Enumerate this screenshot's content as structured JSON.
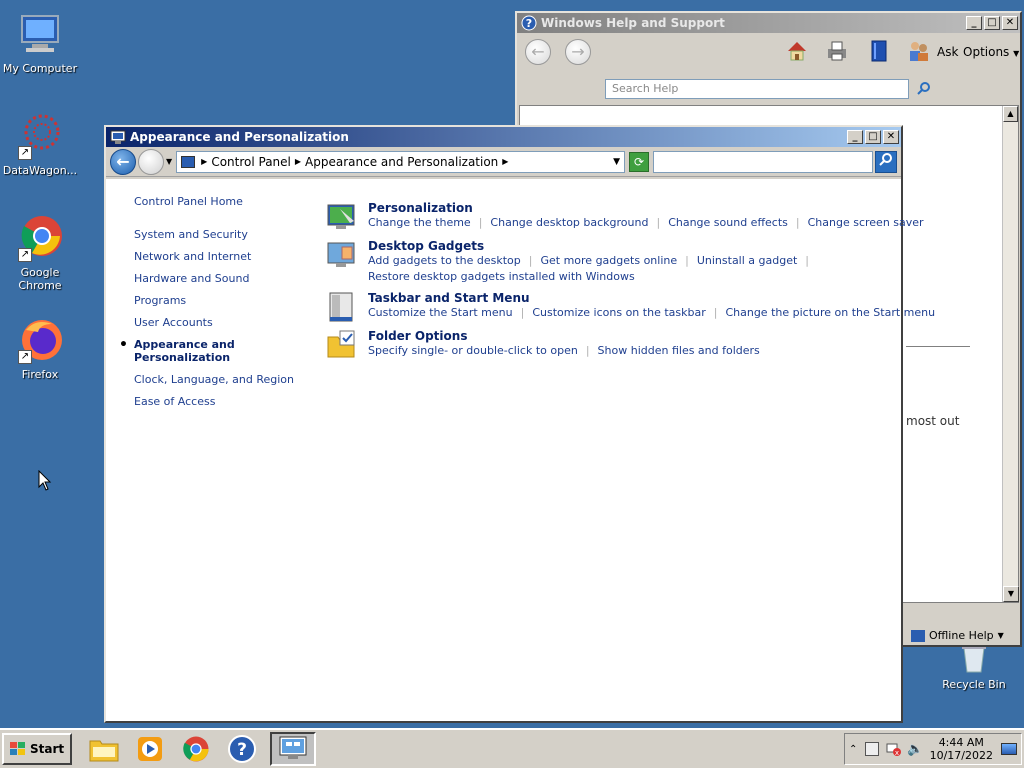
{
  "desktop": {
    "icons": [
      {
        "label": "My Computer"
      },
      {
        "label": "DataWagon..."
      },
      {
        "label": "Google Chrome"
      },
      {
        "label": "Firefox"
      },
      {
        "label": "Recycle Bin"
      }
    ]
  },
  "help_window": {
    "title": "Windows Help and Support",
    "ask_label": "Ask",
    "options_label": "Options",
    "search_placeholder": "Search Help",
    "partial_text": "most out",
    "offline_help_label": "Offline Help"
  },
  "cp_window": {
    "title": "Appearance and Personalization",
    "breadcrumb": [
      "Control Panel",
      "Appearance and Personalization"
    ],
    "left_nav": [
      "Control Panel Home",
      "System and Security",
      "Network and Internet",
      "Hardware and Sound",
      "Programs",
      "User Accounts",
      "Appearance and Personalization",
      "Clock, Language, and Region",
      "Ease of Access"
    ],
    "categories": [
      {
        "title": "Personalization",
        "links": [
          "Change the theme",
          "Change desktop background",
          "Change sound effects",
          "Change screen saver"
        ]
      },
      {
        "title": "Desktop Gadgets",
        "links": [
          "Add gadgets to the desktop",
          "Get more gadgets online",
          "Uninstall a gadget"
        ],
        "links2": [
          "Restore desktop gadgets installed with Windows"
        ]
      },
      {
        "title": "Taskbar and Start Menu",
        "links": [
          "Customize the Start menu",
          "Customize icons on the taskbar",
          "Change the picture on the Start menu"
        ]
      },
      {
        "title": "Folder Options",
        "links": [
          "Specify single- or double-click to open",
          "Show hidden files and folders"
        ]
      }
    ]
  },
  "taskbar": {
    "start_label": "Start",
    "time": "4:44 AM",
    "date": "10/17/2022"
  }
}
